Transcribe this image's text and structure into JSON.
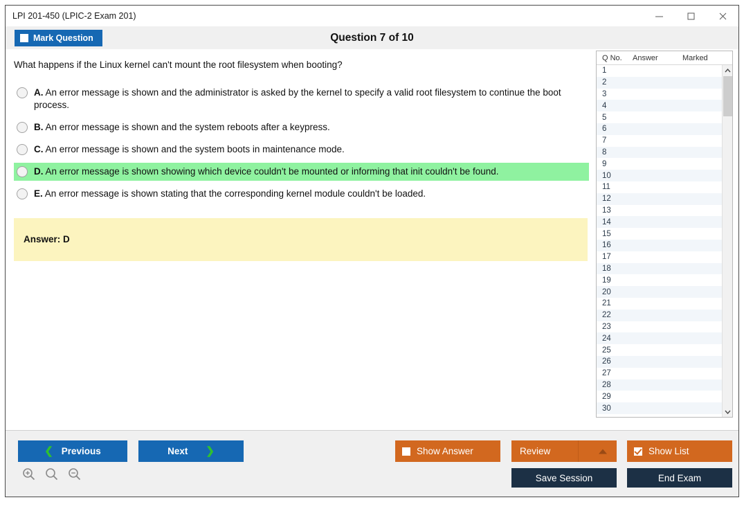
{
  "window": {
    "title": "LPI 201-450 (LPIC-2 Exam 201)",
    "minimize_label": "Minimize",
    "maximize_label": "Maximize",
    "close_label": "Close"
  },
  "header": {
    "mark_question_label": "Mark Question",
    "mark_question_checked": false,
    "question_counter": "Question 7 of 10"
  },
  "question": {
    "stem": "What happens if the Linux kernel can't mount the root filesystem when booting?",
    "options": [
      {
        "letter": "A.",
        "text": "An error message is shown and the administrator is asked by the kernel to specify a valid root filesystem to continue the boot process.",
        "correct": false,
        "selected": false
      },
      {
        "letter": "B.",
        "text": "An error message is shown and the system reboots after a keypress.",
        "correct": false,
        "selected": false
      },
      {
        "letter": "C.",
        "text": "An error message is shown and the system boots in maintenance mode.",
        "correct": false,
        "selected": false
      },
      {
        "letter": "D.",
        "text": "An error message is shown showing which device couldn't be mounted or informing that init couldn't be found.",
        "correct": true,
        "selected": false
      },
      {
        "letter": "E.",
        "text": "An error message is shown stating that the corresponding kernel module couldn't be loaded.",
        "correct": false,
        "selected": false
      }
    ],
    "answer_label": "Answer: D"
  },
  "question_list": {
    "columns": [
      "Q No.",
      "Answer",
      "Marked"
    ],
    "rows": [
      {
        "no": "1",
        "answer": "",
        "marked": ""
      },
      {
        "no": "2",
        "answer": "",
        "marked": ""
      },
      {
        "no": "3",
        "answer": "",
        "marked": ""
      },
      {
        "no": "4",
        "answer": "",
        "marked": ""
      },
      {
        "no": "5",
        "answer": "",
        "marked": ""
      },
      {
        "no": "6",
        "answer": "",
        "marked": ""
      },
      {
        "no": "7",
        "answer": "",
        "marked": ""
      },
      {
        "no": "8",
        "answer": "",
        "marked": ""
      },
      {
        "no": "9",
        "answer": "",
        "marked": ""
      },
      {
        "no": "10",
        "answer": "",
        "marked": ""
      },
      {
        "no": "11",
        "answer": "",
        "marked": ""
      },
      {
        "no": "12",
        "answer": "",
        "marked": ""
      },
      {
        "no": "13",
        "answer": "",
        "marked": ""
      },
      {
        "no": "14",
        "answer": "",
        "marked": ""
      },
      {
        "no": "15",
        "answer": "",
        "marked": ""
      },
      {
        "no": "16",
        "answer": "",
        "marked": ""
      },
      {
        "no": "17",
        "answer": "",
        "marked": ""
      },
      {
        "no": "18",
        "answer": "",
        "marked": ""
      },
      {
        "no": "19",
        "answer": "",
        "marked": ""
      },
      {
        "no": "20",
        "answer": "",
        "marked": ""
      },
      {
        "no": "21",
        "answer": "",
        "marked": ""
      },
      {
        "no": "22",
        "answer": "",
        "marked": ""
      },
      {
        "no": "23",
        "answer": "",
        "marked": ""
      },
      {
        "no": "24",
        "answer": "",
        "marked": ""
      },
      {
        "no": "25",
        "answer": "",
        "marked": ""
      },
      {
        "no": "26",
        "answer": "",
        "marked": ""
      },
      {
        "no": "27",
        "answer": "",
        "marked": ""
      },
      {
        "no": "28",
        "answer": "",
        "marked": ""
      },
      {
        "no": "29",
        "answer": "",
        "marked": ""
      },
      {
        "no": "30",
        "answer": "",
        "marked": ""
      }
    ]
  },
  "footer": {
    "previous_label": "Previous",
    "next_label": "Next",
    "show_answer_label": "Show Answer",
    "show_answer_checked": false,
    "review_label": "Review",
    "show_list_label": "Show List",
    "show_list_checked": true,
    "save_session_label": "Save Session",
    "end_exam_label": "End Exam",
    "zoom_in_label": "Zoom In",
    "zoom_reset_label": "Zoom Reset",
    "zoom_out_label": "Zoom Out"
  },
  "colors": {
    "primary_blue": "#1668b3",
    "accent_orange": "#d2681f",
    "navy": "#1c3045",
    "correct_green": "#8ff2a0",
    "answer_yellow": "#fcf4bf",
    "chevron_green": "#2fc12f"
  }
}
